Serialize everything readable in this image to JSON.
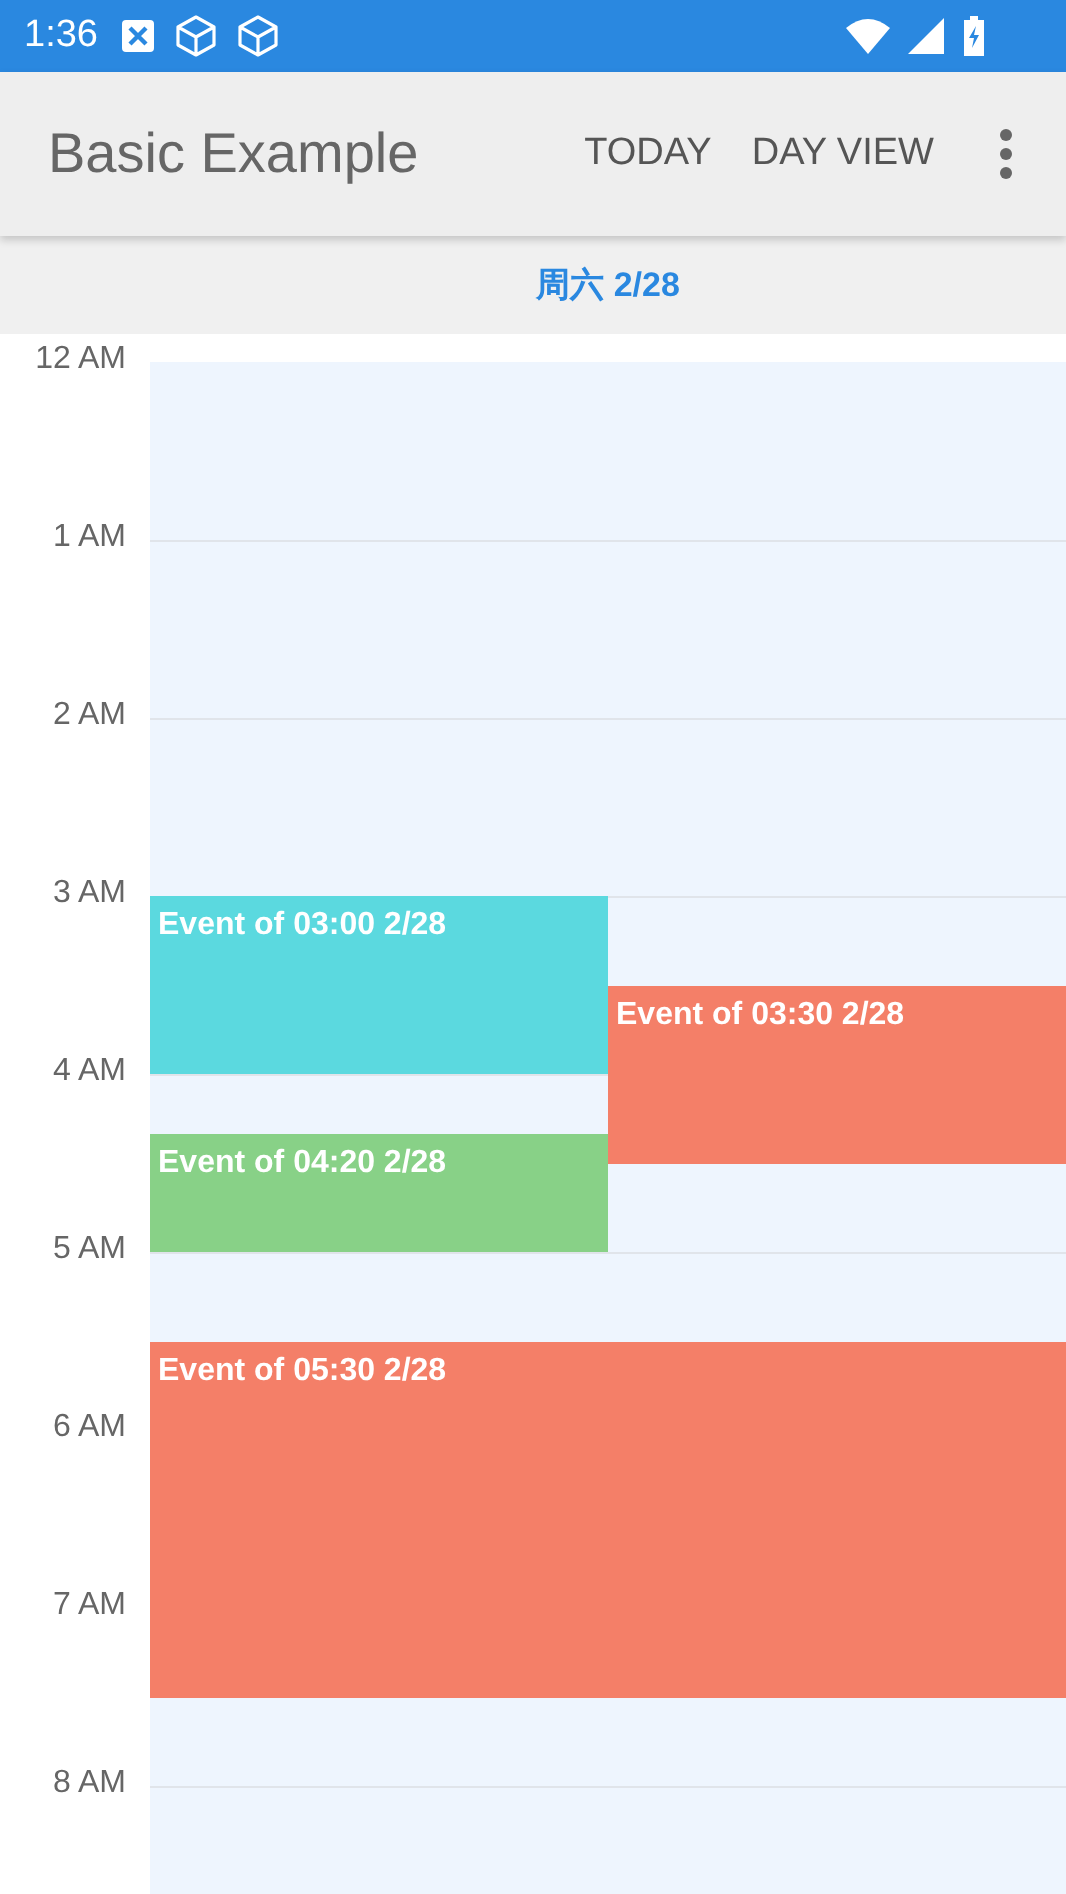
{
  "status_bar": {
    "time": "1:36"
  },
  "app_bar": {
    "title": "Basic Example",
    "actions": [
      "TODAY",
      "DAY VIEW"
    ]
  },
  "day_header": {
    "label": "周六 2/28"
  },
  "hours": [
    "12 AM",
    "1 AM",
    "2 AM",
    "3 AM",
    "4 AM",
    "5 AM",
    "6 AM",
    "7 AM",
    "8 AM"
  ],
  "events": [
    {
      "title": "Event of 03:00 2/28",
      "color": "#5bd9df"
    },
    {
      "title": "Event of 03:30 2/28",
      "color": "#f47f68"
    },
    {
      "title": "Event of 04:20 2/28",
      "color": "#88d187"
    },
    {
      "title": "Event of 05:30 2/28",
      "color": "#f47f68"
    }
  ]
}
